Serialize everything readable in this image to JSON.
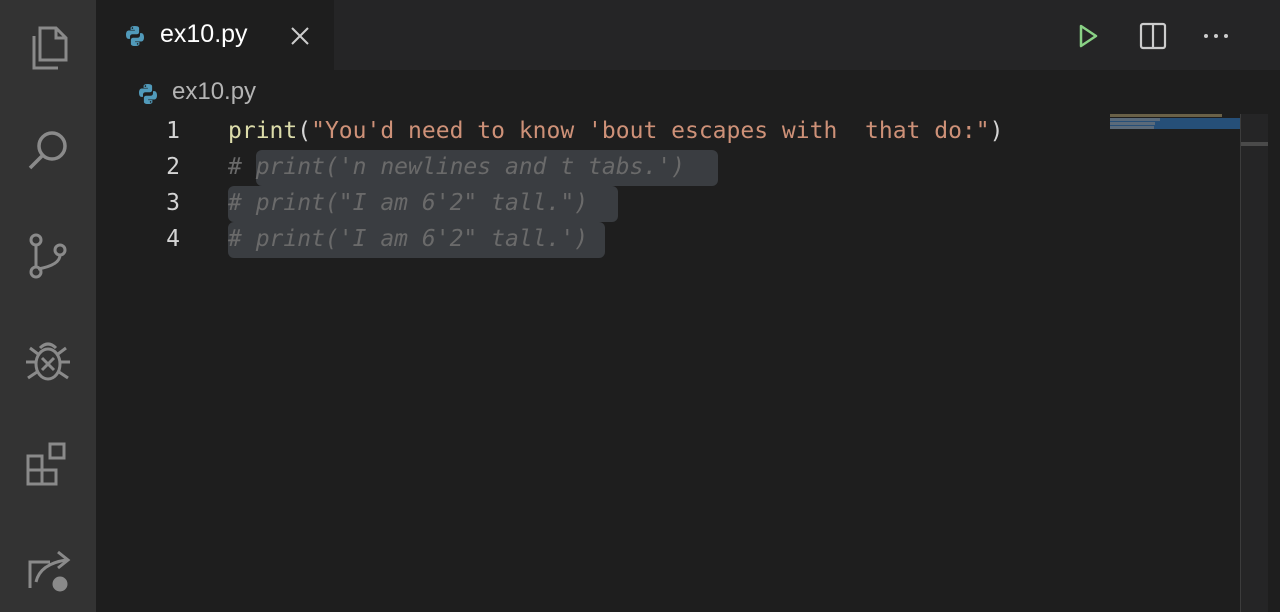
{
  "activity_bar": {
    "icons": [
      "explorer-icon",
      "search-icon",
      "source-control-icon",
      "run-debug-icon",
      "extensions-icon",
      "remote-explorer-icon"
    ]
  },
  "tabs": [
    {
      "label": "ex10.py",
      "active": true
    }
  ],
  "toolbar": {
    "run_icon": "play-icon",
    "split_icon": "split-editor-icon",
    "more_icon": "more-actions-icon"
  },
  "breadcrumb": {
    "file": "ex10.py"
  },
  "editor": {
    "lines": [
      {
        "number": "1",
        "fn": "print",
        "open": "(",
        "str": "\"You'd need to know 'bout escapes with  that do:\"",
        "close": ")"
      },
      {
        "number": "2",
        "hash": "# ",
        "comment": "print('n newlines and t tabs.')"
      },
      {
        "number": "3",
        "hash": "# ",
        "comment": "print(\"I am 6'2\" tall.\")"
      },
      {
        "number": "4",
        "hash": "# ",
        "comment": "print('I am 6'2\" tall.')"
      }
    ]
  },
  "colors": {
    "accent_run": "#89d185",
    "python_blue": "#519aba",
    "selection": "#3a3d41"
  }
}
